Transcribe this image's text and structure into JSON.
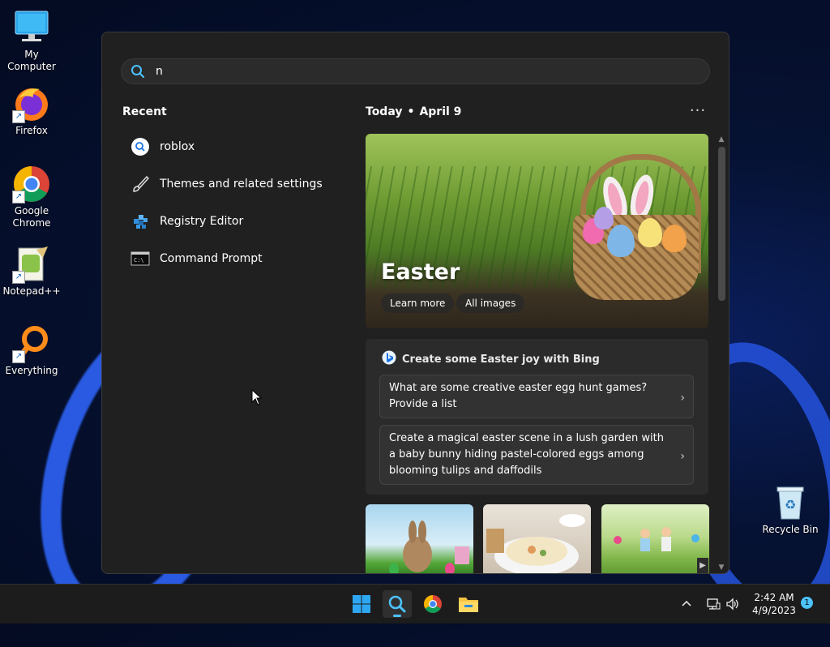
{
  "desktop": {
    "icons": [
      {
        "label": "My Computer"
      },
      {
        "label": "Firefox"
      },
      {
        "label": "Google Chrome"
      },
      {
        "label": "Notepad++"
      },
      {
        "label": "Everything"
      },
      {
        "label": "Recycle Bin"
      }
    ]
  },
  "search": {
    "value": "n"
  },
  "recent": {
    "title": "Recent",
    "items": [
      {
        "label": "roblox",
        "icon": "search-icon"
      },
      {
        "label": "Themes and related settings",
        "icon": "brush-icon"
      },
      {
        "label": "Registry Editor",
        "icon": "registry-icon"
      },
      {
        "label": "Command Prompt",
        "icon": "terminal-icon"
      }
    ]
  },
  "today": {
    "label": "Today",
    "date": "April 9",
    "more": "···"
  },
  "hero": {
    "title": "Easter",
    "learn_more": "Learn more",
    "all_images": "All images"
  },
  "bing": {
    "heading": "Create some Easter joy with Bing",
    "prompts": [
      "What are some creative easter egg hunt games? Provide a list",
      "Create a magical easter scene in a lush garden with a baby bunny hiding pastel-colored eggs among blooming tulips and daffodils"
    ],
    "chevron": "›"
  },
  "taskbar": {
    "clock_time": "2:42 AM",
    "clock_date": "4/9/2023",
    "notification_count": "1",
    "tray_up": "^"
  },
  "colors": {
    "accent": "#4cc2ff",
    "panel_bg": "#202020",
    "card_bg": "#2b2b2b"
  }
}
